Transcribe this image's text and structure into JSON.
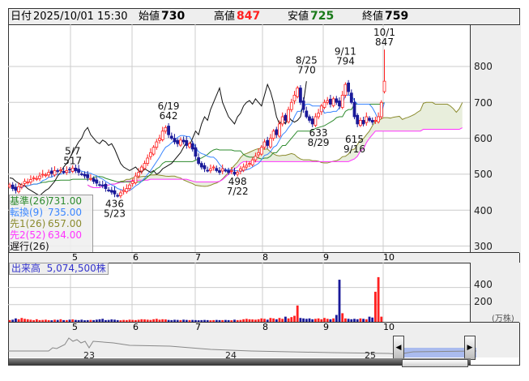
{
  "header": {
    "date_label": "日付",
    "date": "2025/10/01 15:30",
    "open_label": "始値",
    "open": "730",
    "high_label": "高値",
    "high": "847",
    "low_label": "安値",
    "low": "725",
    "close_label": "終値",
    "close": "759"
  },
  "price_axis": [
    "800",
    "700",
    "600",
    "500",
    "400",
    "300"
  ],
  "month_labels": [
    "5",
    "6",
    "7",
    "8",
    "9",
    "10"
  ],
  "legend": [
    {
      "name": "基準(26)",
      "value": "731.00",
      "color": "#2e8b2e"
    },
    {
      "name": "転換(9)",
      "value": "735.00",
      "color": "#3a86ff"
    },
    {
      "name": "先1(26)",
      "value": "657.00",
      "color": "#8b8b2e"
    },
    {
      "name": "先2(52)",
      "value": "634.00",
      "color": "#ff33ff"
    },
    {
      "name": "遅行(26)",
      "value": null,
      "color": "#111111"
    }
  ],
  "volume": {
    "label": "出来高",
    "value": "5,074,500株",
    "axis": [
      "400",
      "200"
    ],
    "unit": "(万株)"
  },
  "navigator": {
    "years": [
      "23",
      "24",
      "25"
    ],
    "left_handle": "◀",
    "right_handle": "▶"
  },
  "colors": {
    "up": "#ff2020",
    "down": "#1a1a99",
    "high": "#ff2020",
    "low": "#1a7a1a"
  },
  "chart_data": {
    "type": "candlestick",
    "annotations": [
      {
        "date": "5/7",
        "value": "517",
        "i": 21
      },
      {
        "date": "5/23",
        "value": "436",
        "i": 35,
        "below": true
      },
      {
        "date": "6/19",
        "value": "642",
        "i": 53
      },
      {
        "date": "7/22",
        "value": "498",
        "i": 76,
        "below": true
      },
      {
        "date": "8/25",
        "value": "770",
        "i": 99
      },
      {
        "date": "8/29",
        "value": "633",
        "i": 103,
        "below": true
      },
      {
        "date": "9/11",
        "value": "794",
        "i": 112
      },
      {
        "date": "9/16",
        "value": "615",
        "i": 115,
        "below": true
      },
      {
        "date": "10/1",
        "value": "847",
        "i": 125
      }
    ],
    "closes": [
      470,
      460,
      455,
      465,
      470,
      480,
      478,
      485,
      490,
      488,
      495,
      500,
      498,
      505,
      502,
      510,
      508,
      512,
      505,
      510,
      512,
      517,
      510,
      505,
      500,
      495,
      490,
      488,
      480,
      475,
      470,
      468,
      460,
      455,
      450,
      445,
      440,
      448,
      455,
      460,
      470,
      480,
      495,
      505,
      520,
      530,
      545,
      560,
      575,
      590,
      600,
      620,
      630,
      610,
      600,
      590,
      585,
      595,
      590,
      580,
      585,
      570,
      550,
      530,
      520,
      515,
      510,
      515,
      520,
      510,
      505,
      515,
      510,
      505,
      510,
      500,
      505,
      515,
      520,
      525,
      530,
      540,
      550,
      560,
      575,
      590,
      580,
      600,
      620,
      610,
      640,
      660,
      650,
      680,
      700,
      720,
      740,
      700,
      680,
      660,
      650,
      640,
      660,
      670,
      690,
      700,
      705,
      695,
      710,
      700,
      690,
      720,
      750,
      730,
      700,
      660,
      640,
      650,
      640,
      660,
      650,
      645,
      650,
      660,
      700,
      759
    ],
    "volumes": [
      20,
      25,
      40,
      30,
      45,
      35,
      30,
      25,
      20,
      30,
      20,
      22,
      25,
      20,
      18,
      25,
      22,
      30,
      20,
      20,
      25,
      28,
      22,
      20,
      25,
      18,
      20,
      22,
      20,
      25,
      30,
      35,
      20,
      22,
      28,
      25,
      20,
      18,
      22,
      20,
      25,
      22,
      20,
      24,
      30,
      28,
      25,
      22,
      30,
      35,
      25,
      30,
      28,
      22,
      20,
      24,
      22,
      20,
      25,
      22,
      20,
      22,
      20,
      18,
      20,
      22,
      20,
      18,
      20,
      22,
      20,
      20,
      22,
      20,
      18,
      25,
      20,
      22,
      30,
      35,
      30,
      28,
      25,
      30,
      40,
      35,
      25,
      45,
      40,
      30,
      45,
      35,
      60,
      40,
      55,
      70,
      190,
      45,
      40,
      35,
      40,
      30,
      35,
      40,
      30,
      45,
      35,
      30,
      40,
      80,
      490,
      100,
      40,
      35,
      30,
      35,
      30,
      40,
      35,
      30,
      60,
      50,
      350,
      520,
      60
    ]
  }
}
